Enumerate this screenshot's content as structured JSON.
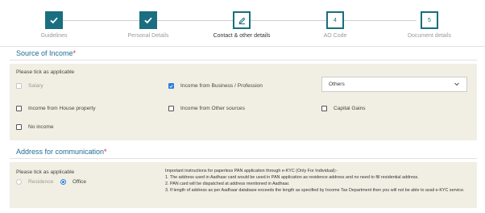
{
  "stepper": {
    "steps": [
      {
        "label": "Guidelines",
        "status": "done",
        "marker": ""
      },
      {
        "label": "Personal Details",
        "status": "done",
        "marker": ""
      },
      {
        "label": "Contact & other details",
        "status": "current",
        "marker": ""
      },
      {
        "label": "AO Code",
        "status": "pending",
        "marker": "4"
      },
      {
        "label": "Document details",
        "status": "pending",
        "marker": "5"
      }
    ]
  },
  "income_section": {
    "title": "Source of Income",
    "required_mark": "*",
    "hint": "Please tick as applicable",
    "options": {
      "salary": {
        "label": "Salary",
        "checked": false,
        "disabled": true
      },
      "business": {
        "label": "Income from Business / Profession",
        "checked": true,
        "disabled": false
      },
      "house_property": {
        "label": "Income from House property",
        "checked": false,
        "disabled": false
      },
      "other_sources": {
        "label": "Income from Other sources",
        "checked": false,
        "disabled": false
      },
      "capital_gains": {
        "label": "Capital Gains",
        "checked": false,
        "disabled": false
      },
      "no_income": {
        "label": "No income",
        "checked": false,
        "disabled": false
      }
    },
    "business_type_select": {
      "value": "Others"
    }
  },
  "address_section": {
    "title": "Address for communication",
    "required_mark": "*",
    "hint": "Please tick as applicable",
    "options": {
      "residence": {
        "label": "Residence",
        "selected": false,
        "disabled": true
      },
      "office": {
        "label": "Office",
        "selected": true,
        "disabled": false
      }
    },
    "instructions": {
      "heading": "Important instructions for paperless PAN application through e-KYC (Only For Individual):-",
      "items": [
        "1. The address used in Aadhaar card would be used in PAN application as residence address and no need to fill residential address.",
        "2. PAN card will be dispatched at address mentioned in Aadhaar.",
        "3. If length of address as per Aadhaar database exceeds the length as specified by Income Tax Department then you will not be able to avail e-KYC service."
      ]
    }
  },
  "colors": {
    "accent": "#1a6e80",
    "heading": "#1e6b93",
    "panel": "#f1efe3",
    "required": "#d8232a",
    "checked": "#2f7ee0"
  },
  "icons": {
    "done": "check-icon",
    "current": "pencil-icon",
    "select": "chevron-down-icon"
  }
}
